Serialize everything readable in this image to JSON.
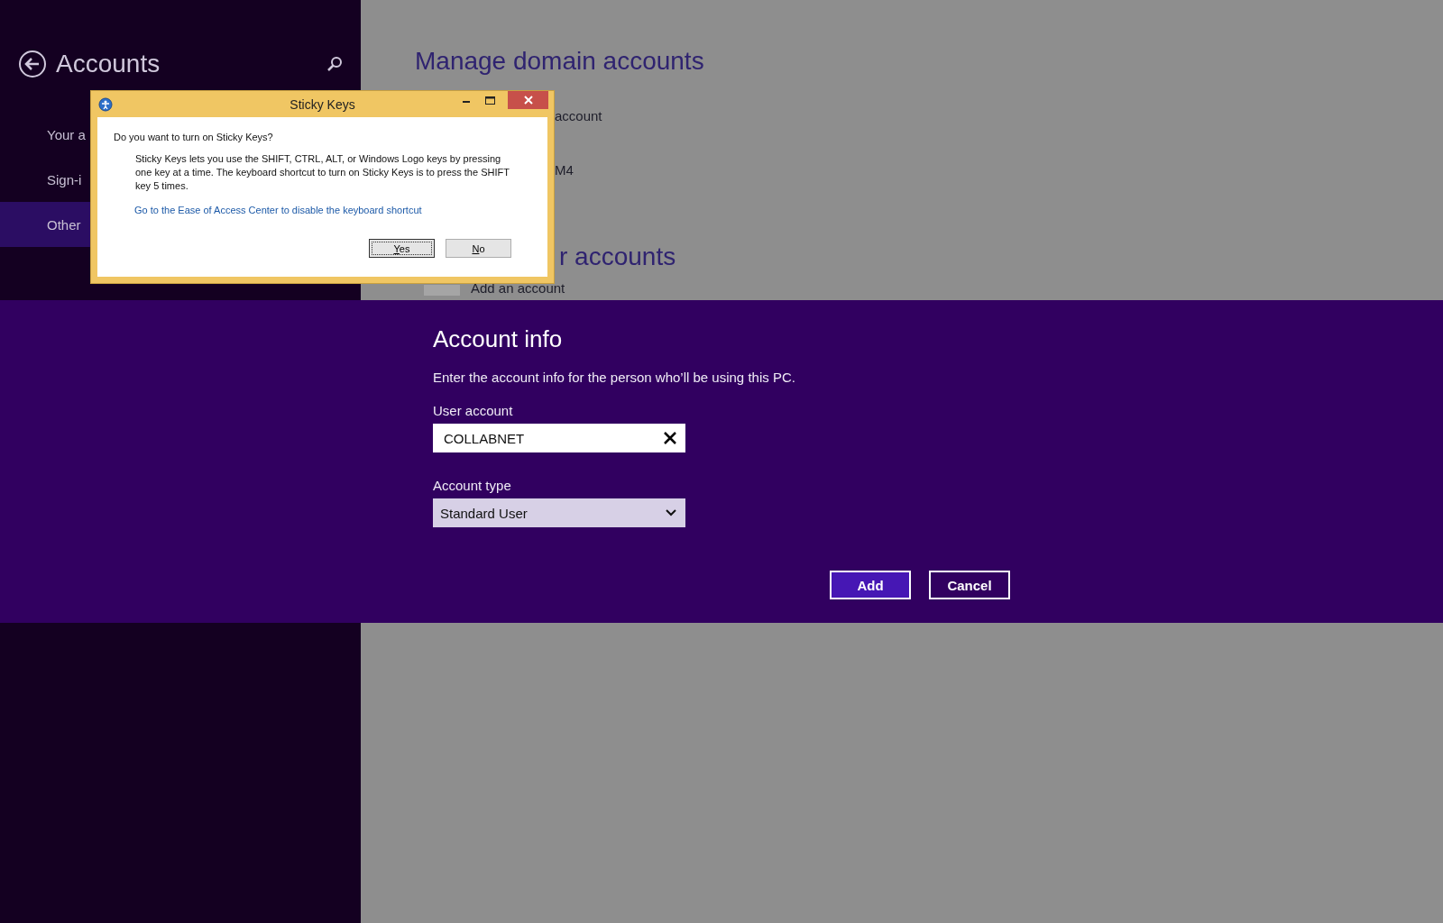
{
  "sidebar": {
    "title": "Accounts",
    "items": [
      {
        "label": "Your a",
        "selected": false
      },
      {
        "label": "Sign-i",
        "selected": false
      },
      {
        "label": "Other",
        "selected": true
      }
    ]
  },
  "main": {
    "heading": "Manage domain accounts",
    "lines": [
      "account",
      "M4"
    ],
    "heading_2": "r accounts",
    "add_label": "Add an account"
  },
  "account_info": {
    "title": "Account info",
    "description": "Enter the account info for the person who’ll be using this PC.",
    "user_account": {
      "label": "User account",
      "value": "COLLABNET"
    },
    "account_type": {
      "label": "Account type",
      "value": "Standard User"
    },
    "buttons": [
      {
        "label": "Add",
        "kind": "primary"
      },
      {
        "label": "Cancel",
        "kind": "secondary"
      }
    ]
  },
  "sticky_keys": {
    "title": "Sticky Keys",
    "question": "Do you want to turn on Sticky Keys?",
    "body": "Sticky Keys lets you use the SHIFT, CTRL, ALT, or Windows Logo keys by pressing one key at a time. The keyboard shortcut to turn on Sticky Keys is to press the SHIFT key 5 times.",
    "link": "Go to the Ease of Access Center to disable the keyboard shortcut",
    "buttons": [
      {
        "label": "Yes",
        "focused": true
      },
      {
        "label": "No",
        "focused": false
      }
    ]
  }
}
